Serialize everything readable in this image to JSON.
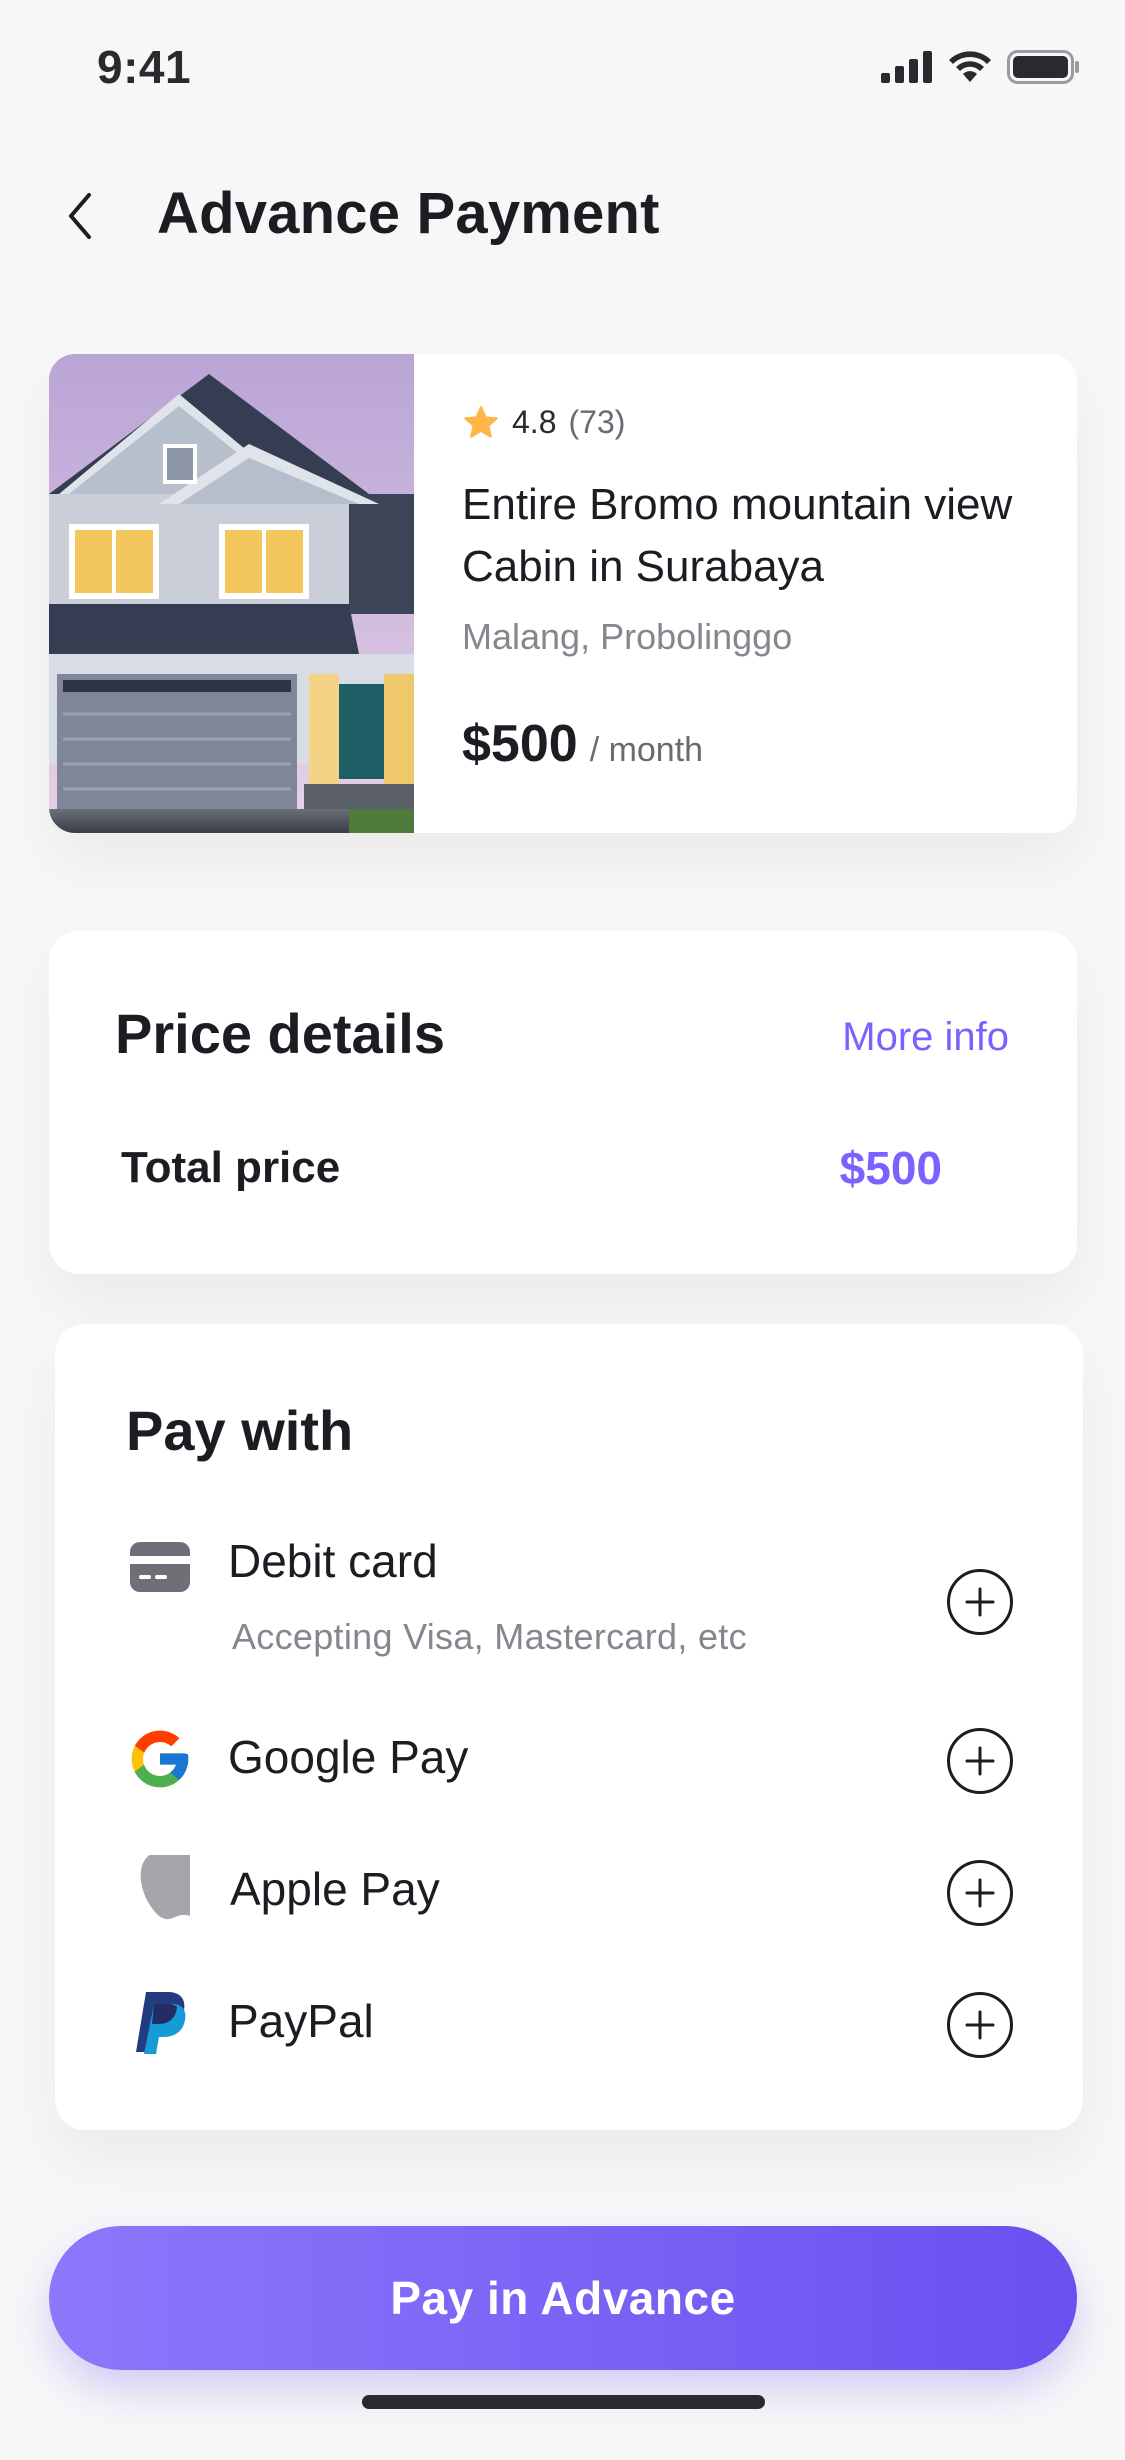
{
  "status_bar": {
    "time": "9:41"
  },
  "header": {
    "title": "Advance Payment",
    "back_icon": "chevron-left-icon"
  },
  "listing": {
    "rating": "4.8",
    "reviews": "(73)",
    "title": "Entire Bromo mountain view Cabin in Surabaya",
    "location": "Malang, Probolinggo",
    "price": "$500",
    "period": "/ month",
    "star_color": "#ffb547"
  },
  "price_details": {
    "title": "Price details",
    "more_info": "More info",
    "total_label": "Total price",
    "total_value": "$500"
  },
  "pay_with": {
    "title": "Pay with",
    "options": [
      {
        "label": "Debit card",
        "subtitle": "Accepting Visa, Mastercard, etc",
        "icon": "credit-card-icon"
      },
      {
        "label": "Google Pay",
        "icon": "google-logo-icon"
      },
      {
        "label": "Apple Pay",
        "icon": "apple-logo-icon"
      },
      {
        "label": "PayPal",
        "icon": "paypal-logo-icon"
      }
    ]
  },
  "actions": {
    "pay_button": "Pay in Advance"
  },
  "colors": {
    "accent": "#7b61ff",
    "button_start": "#8b78fb",
    "button_end": "#6b4ff0"
  }
}
